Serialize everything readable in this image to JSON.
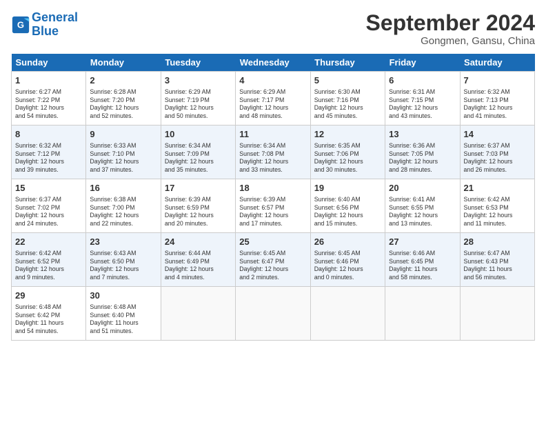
{
  "logo": {
    "line1": "General",
    "line2": "Blue"
  },
  "header": {
    "month": "September 2024",
    "location": "Gongmen, Gansu, China"
  },
  "weekdays": [
    "Sunday",
    "Monday",
    "Tuesday",
    "Wednesday",
    "Thursday",
    "Friday",
    "Saturday"
  ],
  "weeks": [
    [
      {
        "day": "1",
        "detail": "Sunrise: 6:27 AM\nSunset: 7:22 PM\nDaylight: 12 hours\nand 54 minutes."
      },
      {
        "day": "2",
        "detail": "Sunrise: 6:28 AM\nSunset: 7:20 PM\nDaylight: 12 hours\nand 52 minutes."
      },
      {
        "day": "3",
        "detail": "Sunrise: 6:29 AM\nSunset: 7:19 PM\nDaylight: 12 hours\nand 50 minutes."
      },
      {
        "day": "4",
        "detail": "Sunrise: 6:29 AM\nSunset: 7:17 PM\nDaylight: 12 hours\nand 48 minutes."
      },
      {
        "day": "5",
        "detail": "Sunrise: 6:30 AM\nSunset: 7:16 PM\nDaylight: 12 hours\nand 45 minutes."
      },
      {
        "day": "6",
        "detail": "Sunrise: 6:31 AM\nSunset: 7:15 PM\nDaylight: 12 hours\nand 43 minutes."
      },
      {
        "day": "7",
        "detail": "Sunrise: 6:32 AM\nSunset: 7:13 PM\nDaylight: 12 hours\nand 41 minutes."
      }
    ],
    [
      {
        "day": "8",
        "detail": "Sunrise: 6:32 AM\nSunset: 7:12 PM\nDaylight: 12 hours\nand 39 minutes."
      },
      {
        "day": "9",
        "detail": "Sunrise: 6:33 AM\nSunset: 7:10 PM\nDaylight: 12 hours\nand 37 minutes."
      },
      {
        "day": "10",
        "detail": "Sunrise: 6:34 AM\nSunset: 7:09 PM\nDaylight: 12 hours\nand 35 minutes."
      },
      {
        "day": "11",
        "detail": "Sunrise: 6:34 AM\nSunset: 7:08 PM\nDaylight: 12 hours\nand 33 minutes."
      },
      {
        "day": "12",
        "detail": "Sunrise: 6:35 AM\nSunset: 7:06 PM\nDaylight: 12 hours\nand 30 minutes."
      },
      {
        "day": "13",
        "detail": "Sunrise: 6:36 AM\nSunset: 7:05 PM\nDaylight: 12 hours\nand 28 minutes."
      },
      {
        "day": "14",
        "detail": "Sunrise: 6:37 AM\nSunset: 7:03 PM\nDaylight: 12 hours\nand 26 minutes."
      }
    ],
    [
      {
        "day": "15",
        "detail": "Sunrise: 6:37 AM\nSunset: 7:02 PM\nDaylight: 12 hours\nand 24 minutes."
      },
      {
        "day": "16",
        "detail": "Sunrise: 6:38 AM\nSunset: 7:00 PM\nDaylight: 12 hours\nand 22 minutes."
      },
      {
        "day": "17",
        "detail": "Sunrise: 6:39 AM\nSunset: 6:59 PM\nDaylight: 12 hours\nand 20 minutes."
      },
      {
        "day": "18",
        "detail": "Sunrise: 6:39 AM\nSunset: 6:57 PM\nDaylight: 12 hours\nand 17 minutes."
      },
      {
        "day": "19",
        "detail": "Sunrise: 6:40 AM\nSunset: 6:56 PM\nDaylight: 12 hours\nand 15 minutes."
      },
      {
        "day": "20",
        "detail": "Sunrise: 6:41 AM\nSunset: 6:55 PM\nDaylight: 12 hours\nand 13 minutes."
      },
      {
        "day": "21",
        "detail": "Sunrise: 6:42 AM\nSunset: 6:53 PM\nDaylight: 12 hours\nand 11 minutes."
      }
    ],
    [
      {
        "day": "22",
        "detail": "Sunrise: 6:42 AM\nSunset: 6:52 PM\nDaylight: 12 hours\nand 9 minutes."
      },
      {
        "day": "23",
        "detail": "Sunrise: 6:43 AM\nSunset: 6:50 PM\nDaylight: 12 hours\nand 7 minutes."
      },
      {
        "day": "24",
        "detail": "Sunrise: 6:44 AM\nSunset: 6:49 PM\nDaylight: 12 hours\nand 4 minutes."
      },
      {
        "day": "25",
        "detail": "Sunrise: 6:45 AM\nSunset: 6:47 PM\nDaylight: 12 hours\nand 2 minutes."
      },
      {
        "day": "26",
        "detail": "Sunrise: 6:45 AM\nSunset: 6:46 PM\nDaylight: 12 hours\nand 0 minutes."
      },
      {
        "day": "27",
        "detail": "Sunrise: 6:46 AM\nSunset: 6:45 PM\nDaylight: 11 hours\nand 58 minutes."
      },
      {
        "day": "28",
        "detail": "Sunrise: 6:47 AM\nSunset: 6:43 PM\nDaylight: 11 hours\nand 56 minutes."
      }
    ],
    [
      {
        "day": "29",
        "detail": "Sunrise: 6:48 AM\nSunset: 6:42 PM\nDaylight: 11 hours\nand 54 minutes."
      },
      {
        "day": "30",
        "detail": "Sunrise: 6:48 AM\nSunset: 6:40 PM\nDaylight: 11 hours\nand 51 minutes."
      },
      {
        "day": "",
        "detail": ""
      },
      {
        "day": "",
        "detail": ""
      },
      {
        "day": "",
        "detail": ""
      },
      {
        "day": "",
        "detail": ""
      },
      {
        "day": "",
        "detail": ""
      }
    ]
  ]
}
